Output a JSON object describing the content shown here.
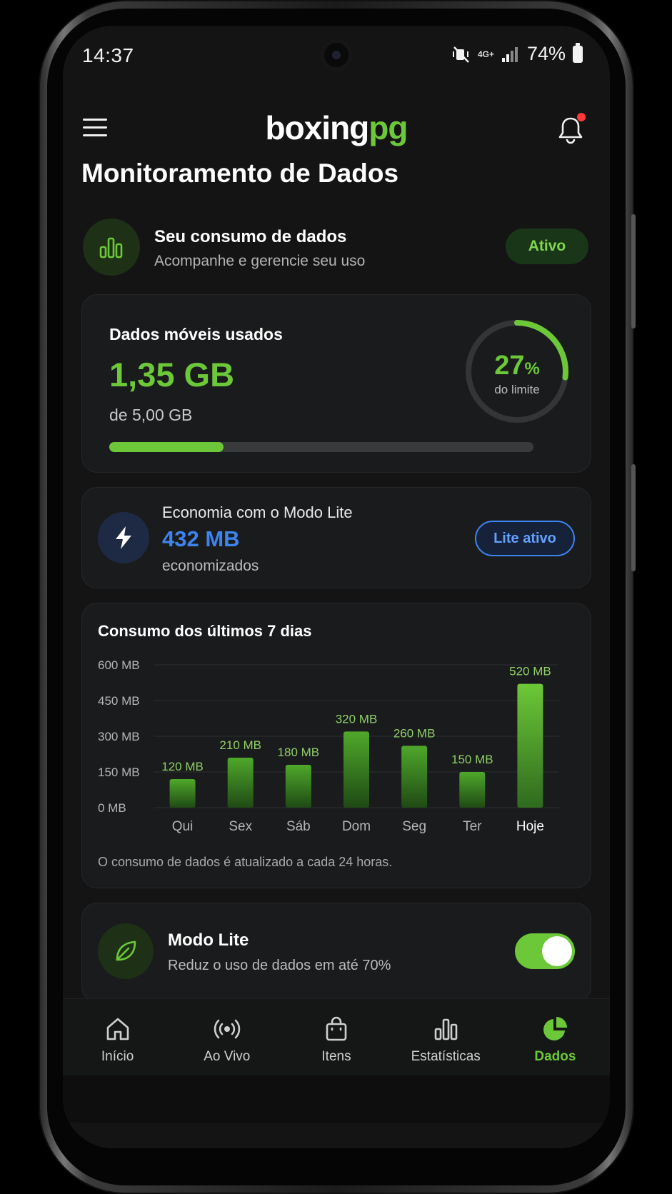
{
  "status": {
    "time": "14:37",
    "network": "4G+",
    "battery": "74%"
  },
  "header": {
    "logo_main": "boxing",
    "logo_accent": "pg",
    "has_notification": true
  },
  "page": {
    "title": "Monitoramento de Dados"
  },
  "summary": {
    "title": "Seu consumo de dados",
    "subtitle": "Acompanhe e gerencie seu uso",
    "badge": "Ativo"
  },
  "usage": {
    "label": "Dados móveis usados",
    "value": "1,35 GB",
    "limit": "de 5,00 GB",
    "percent": "27",
    "percent_symbol": "%",
    "ring_label": "do limite",
    "progress_fraction": 0.27
  },
  "lite_savings": {
    "title": "Economia com o Modo Lite",
    "value": "432 MB",
    "subtitle": "economizados",
    "button": "Lite ativo"
  },
  "chart": {
    "title": "Consumo dos últimos 7 dias",
    "note": "O consumo de dados é atualizado a cada 24 horas."
  },
  "chart_data": {
    "type": "bar",
    "categories": [
      "Qui",
      "Sex",
      "Sáb",
      "Dom",
      "Seg",
      "Ter",
      "Hoje"
    ],
    "values": [
      120,
      210,
      180,
      320,
      260,
      150,
      520
    ],
    "value_labels": [
      "120 MB",
      "210 MB",
      "180 MB",
      "320 MB",
      "260 MB",
      "150 MB",
      "520 MB"
    ],
    "yticks": [
      "0 MB",
      "150 MB",
      "300 MB",
      "450 MB",
      "600 MB"
    ],
    "ylim": [
      0,
      600
    ],
    "grid": true,
    "highlight_category": "Hoje"
  },
  "modo_lite": {
    "title": "Modo Lite",
    "subtitle": "Reduz o uso de dados em até 70%",
    "enabled": true
  },
  "nav": {
    "items": [
      {
        "label": "Início",
        "icon": "home-icon"
      },
      {
        "label": "Ao Vivo",
        "icon": "live-broadcast-icon"
      },
      {
        "label": "Itens",
        "icon": "shopping-bag-icon"
      },
      {
        "label": "Estatísticas",
        "icon": "bar-chart-icon"
      },
      {
        "label": "Dados",
        "icon": "pie-chart-icon"
      }
    ],
    "active": "Dados"
  },
  "colors": {
    "accent_green": "#6cc838",
    "accent_blue": "#3d84ef",
    "background": "#141415",
    "card": "#1a1b1c"
  }
}
